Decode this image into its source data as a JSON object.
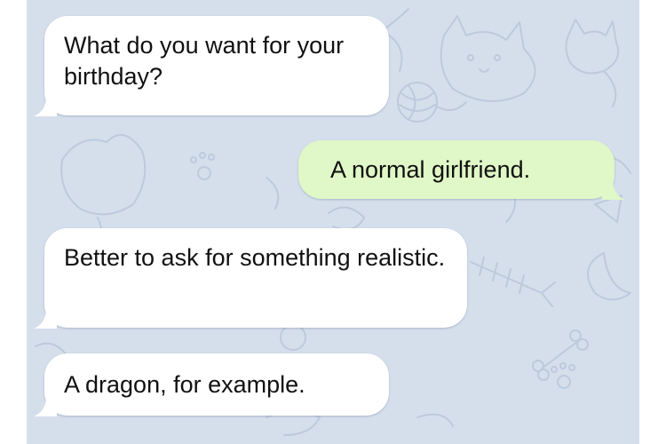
{
  "messages": [
    {
      "direction": "incoming",
      "text": "What do you want for your birthday?"
    },
    {
      "direction": "outgoing",
      "text": "A normal girlfriend."
    },
    {
      "direction": "incoming",
      "text": "Better to ask for something realistic."
    },
    {
      "direction": "incoming",
      "text": "A dragon, for example."
    }
  ],
  "colors": {
    "background": "#d5dfec",
    "incoming_bubble": "#ffffff",
    "outgoing_bubble": "#e0f7c7",
    "doodle": "#bccadc"
  },
  "background_pattern": [
    "cat-icon",
    "paw-icon",
    "yarn-ball-icon",
    "fish-bone-icon",
    "bone-icon",
    "dog-icon"
  ]
}
